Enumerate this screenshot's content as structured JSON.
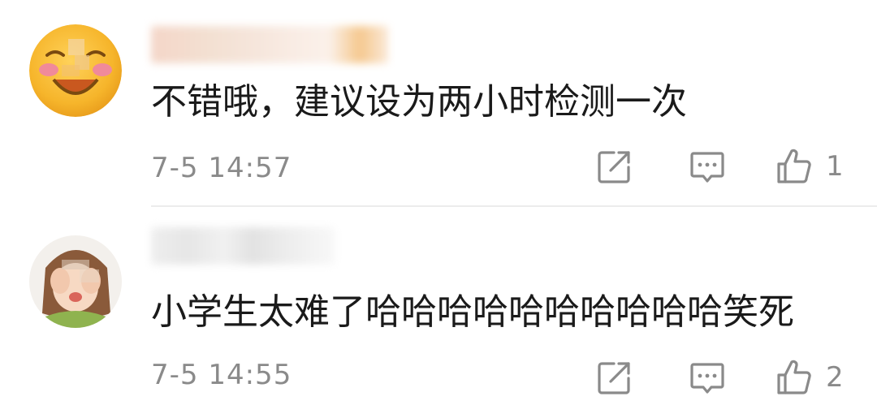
{
  "comments": [
    {
      "text": "不错哦，建议设为两小时检测一次",
      "time": "7-5 14:57",
      "likes": "1",
      "avatar_icon": "laughing-emoji-avatar"
    },
    {
      "text": "小学生太难了哈哈哈哈哈哈哈哈哈哈笑死",
      "time": "7-5 14:55",
      "likes": "2",
      "avatar_icon": "girl-covering-face-avatar"
    }
  ],
  "icons": {
    "share": "share-icon",
    "reply": "comment-icon",
    "like": "thumbs-up-icon"
  },
  "colors": {
    "text": "#1a1a1a",
    "meta": "#8a8a8a",
    "divider": "#ececec"
  }
}
